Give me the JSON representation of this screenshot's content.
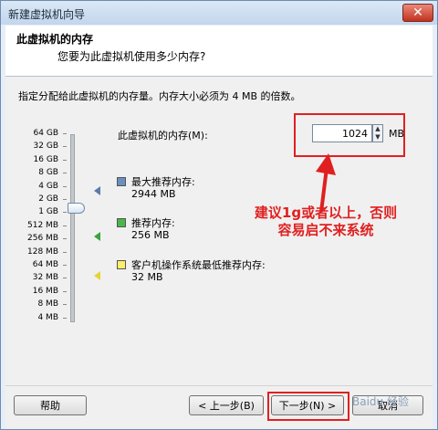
{
  "window": {
    "title": "新建虚拟机向导",
    "close_glyph": "✕"
  },
  "header": {
    "title": "此虚拟机的内存",
    "subtitle": "您要为此虚拟机使用多少内存?"
  },
  "content": {
    "instruction": "指定分配给此虚拟机的内存量。内存大小必须为 4 MB 的倍数。",
    "scale_labels": [
      "64 GB",
      "32 GB",
      "16 GB",
      "8 GB",
      "4 GB",
      "2 GB",
      "1 GB",
      "512 MB",
      "256 MB",
      "128 MB",
      "64 MB",
      "32 MB",
      "16 MB",
      "8 MB",
      "4 MB"
    ],
    "memory_label": "此虚拟机的内存(M):",
    "memory_value": "1024",
    "unit": "MB",
    "legend": [
      {
        "label": "最大推荐内存:",
        "value": "2944 MB",
        "color": "#6a8fc0",
        "marker_color": "#5a7da8"
      },
      {
        "label": "推荐内存:",
        "value": "256 MB",
        "color": "#49b84a",
        "marker_color": "#3aa33c"
      },
      {
        "label": "客户机操作系统最低推荐内存:",
        "value": "32 MB",
        "color": "#ffee66",
        "marker_color": "#e6d33a"
      }
    ],
    "annotation_line1": "建议1g或者以上，否则",
    "annotation_line2": "容易启不来系统"
  },
  "footer": {
    "help": "帮助",
    "back": "< 上一步(B)",
    "next": "下一步(N) >",
    "cancel": "取消",
    "watermark": "Baidu 经验"
  },
  "colors": {
    "annotation": "#e02020"
  }
}
